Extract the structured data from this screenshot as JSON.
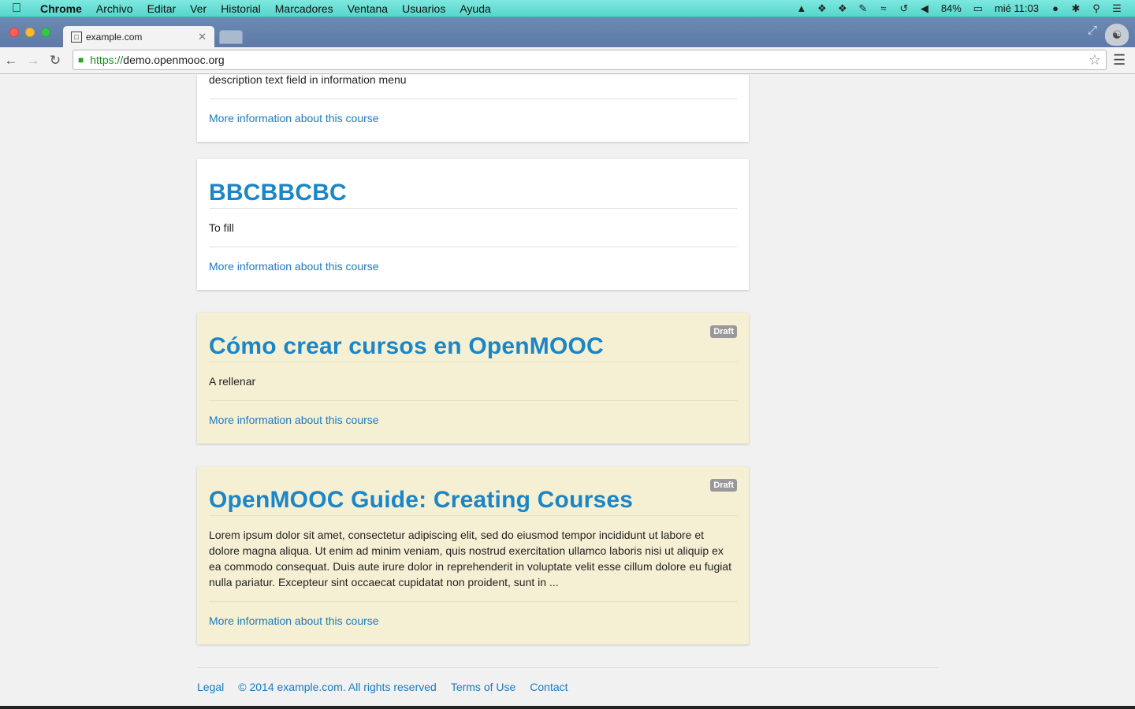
{
  "menubar": {
    "app_name": "Chrome",
    "items": [
      "Archivo",
      "Editar",
      "Ver",
      "Historial",
      "Marcadores",
      "Ventana",
      "Usuarios",
      "Ayuda"
    ],
    "battery": "84%",
    "clock": "mié 11:03"
  },
  "browser": {
    "tab_title": "example.com",
    "url_scheme": "https://",
    "url_host": "demo.openmooc.org"
  },
  "courses": [
    {
      "title": "",
      "description": "description text field in information menu",
      "more_link": "More information about this course",
      "draft": false
    },
    {
      "title": "BBCBBCBC",
      "description": "To fill",
      "more_link": "More information about this course",
      "draft": false
    },
    {
      "title": "Cómo crear cursos en OpenMOOC",
      "description": "A rellenar",
      "more_link": "More information about this course",
      "draft": true,
      "badge": "Draft"
    },
    {
      "title": "OpenMOOC Guide: Creating Courses",
      "description": "Lorem ipsum dolor sit amet, consectetur adipiscing elit, sed do eiusmod tempor incididunt ut labore et dolore magna aliqua. Ut enim ad minim veniam, quis nostrud exercitation ullamco laboris nisi ut aliquip ex ea commodo consequat. Duis aute irure dolor in reprehenderit in voluptate velit esse cillum dolore eu fugiat nulla pariatur. Excepteur sint occaecat cupidatat non proident, sunt in ...",
      "more_link": "More information about this course",
      "draft": true,
      "badge": "Draft"
    }
  ],
  "footer": {
    "legal": "Legal",
    "copyright": "© 2014 example.com. All rights reserved",
    "terms": "Terms of Use",
    "contact": "Contact"
  },
  "colors": {
    "link": "#1a7ac4",
    "title": "#1a86c9",
    "draft_background": "#f5f0d3"
  }
}
